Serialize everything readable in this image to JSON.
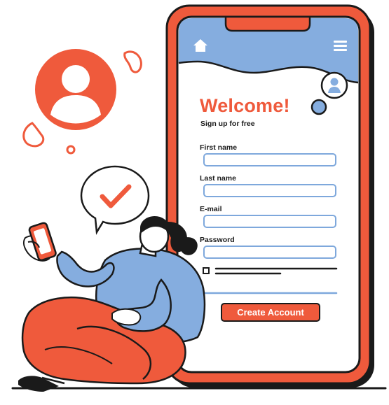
{
  "form": {
    "title": "Welcome!",
    "subtitle": "Sign up for free",
    "fields": [
      {
        "label": "First name",
        "value": ""
      },
      {
        "label": "Last name",
        "value": ""
      },
      {
        "label": "E-mail",
        "value": ""
      },
      {
        "label": "Password",
        "value": ""
      }
    ],
    "submit_label": "Create Account"
  },
  "icons": {
    "home": "home-icon",
    "menu": "hamburger-menu-icon",
    "profile": "user-avatar-icon",
    "check": "checkmark-icon"
  },
  "colors": {
    "accent": "#ef5a3c",
    "header_blue": "#85addf",
    "input_border": "#7ea8dc",
    "ink": "#1a1a1a"
  }
}
